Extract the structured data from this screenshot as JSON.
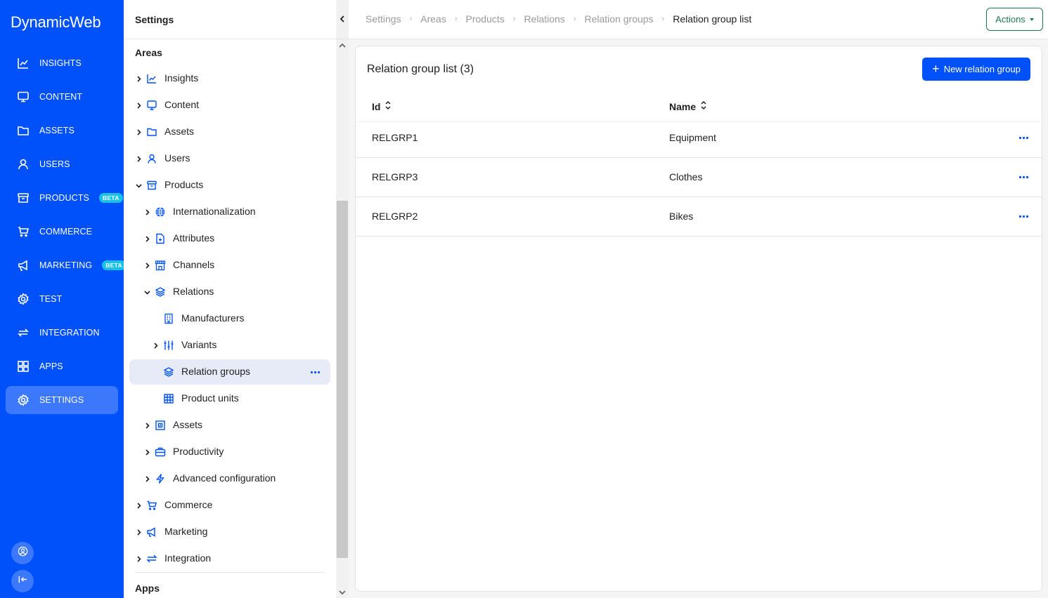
{
  "app": {
    "logo": "DynamicWeb",
    "accent_color": "#0051fa",
    "active_nav_color": "#3b78fb"
  },
  "mainnav": {
    "items": [
      {
        "label": "INSIGHTS",
        "icon": "chart-line-icon"
      },
      {
        "label": "CONTENT",
        "icon": "monitor-icon"
      },
      {
        "label": "ASSETS",
        "icon": "folder-icon"
      },
      {
        "label": "USERS",
        "icon": "user-icon"
      },
      {
        "label": "PRODUCTS",
        "icon": "archive-box-icon",
        "badge": "BETA"
      },
      {
        "label": "COMMERCE",
        "icon": "cart-icon"
      },
      {
        "label": "MARKETING",
        "icon": "megaphone-icon",
        "badge": "BETA"
      },
      {
        "label": "TEST",
        "icon": "gear-icon"
      },
      {
        "label": "INTEGRATION",
        "icon": "arrows-exchange-icon"
      },
      {
        "label": "APPS",
        "icon": "grid-icon"
      },
      {
        "label": "SETTINGS",
        "icon": "gear-icon",
        "active": true
      }
    ],
    "bottom": [
      {
        "icon": "user-circle-icon"
      },
      {
        "icon": "collapse-left-icon"
      }
    ]
  },
  "tree": {
    "header": "Settings",
    "areas_title": "Areas",
    "apps_title": "Apps",
    "items": [
      {
        "label": "Insights",
        "icon": "chart-line-icon",
        "expanded": false
      },
      {
        "label": "Content",
        "icon": "monitor-icon",
        "expanded": false
      },
      {
        "label": "Assets",
        "icon": "folder-icon",
        "expanded": false
      },
      {
        "label": "Users",
        "icon": "user-icon",
        "expanded": false
      },
      {
        "label": "Products",
        "icon": "archive-box-icon",
        "expanded": true
      },
      {
        "label": "Internationalization",
        "icon": "globe-icon",
        "expanded": false
      },
      {
        "label": "Attributes",
        "icon": "file-plus-icon",
        "expanded": false
      },
      {
        "label": "Channels",
        "icon": "storefront-icon",
        "expanded": false
      },
      {
        "label": "Relations",
        "icon": "stack-icon",
        "expanded": true
      },
      {
        "label": "Manufacturers",
        "icon": "building-icon"
      },
      {
        "label": "Variants",
        "icon": "sliders-icon",
        "expanded": false
      },
      {
        "label": "Relation groups",
        "icon": "stack-icon",
        "selected": true
      },
      {
        "label": "Product units",
        "icon": "table-grid-icon"
      },
      {
        "label": "Assets",
        "icon": "frame-icon",
        "expanded": false
      },
      {
        "label": "Productivity",
        "icon": "briefcase-icon",
        "expanded": false
      },
      {
        "label": "Advanced configuration",
        "icon": "lightning-icon",
        "expanded": false
      },
      {
        "label": "Commerce",
        "icon": "cart-icon",
        "expanded": false
      },
      {
        "label": "Marketing",
        "icon": "megaphone-icon",
        "expanded": false
      },
      {
        "label": "Integration",
        "icon": "arrows-exchange-icon",
        "expanded": false
      }
    ]
  },
  "breadcrumb": [
    "Settings",
    "Areas",
    "Products",
    "Relations",
    "Relation groups",
    "Relation group list"
  ],
  "toolbar": {
    "actions_label": "Actions"
  },
  "main": {
    "title": "Relation group list (3)",
    "new_button_label": "New relation group",
    "columns": [
      "Id",
      "Name"
    ],
    "rows": [
      {
        "id": "RELGRP1",
        "name": "Equipment"
      },
      {
        "id": "RELGRP3",
        "name": "Clothes"
      },
      {
        "id": "RELGRP2",
        "name": "Bikes"
      }
    ]
  }
}
